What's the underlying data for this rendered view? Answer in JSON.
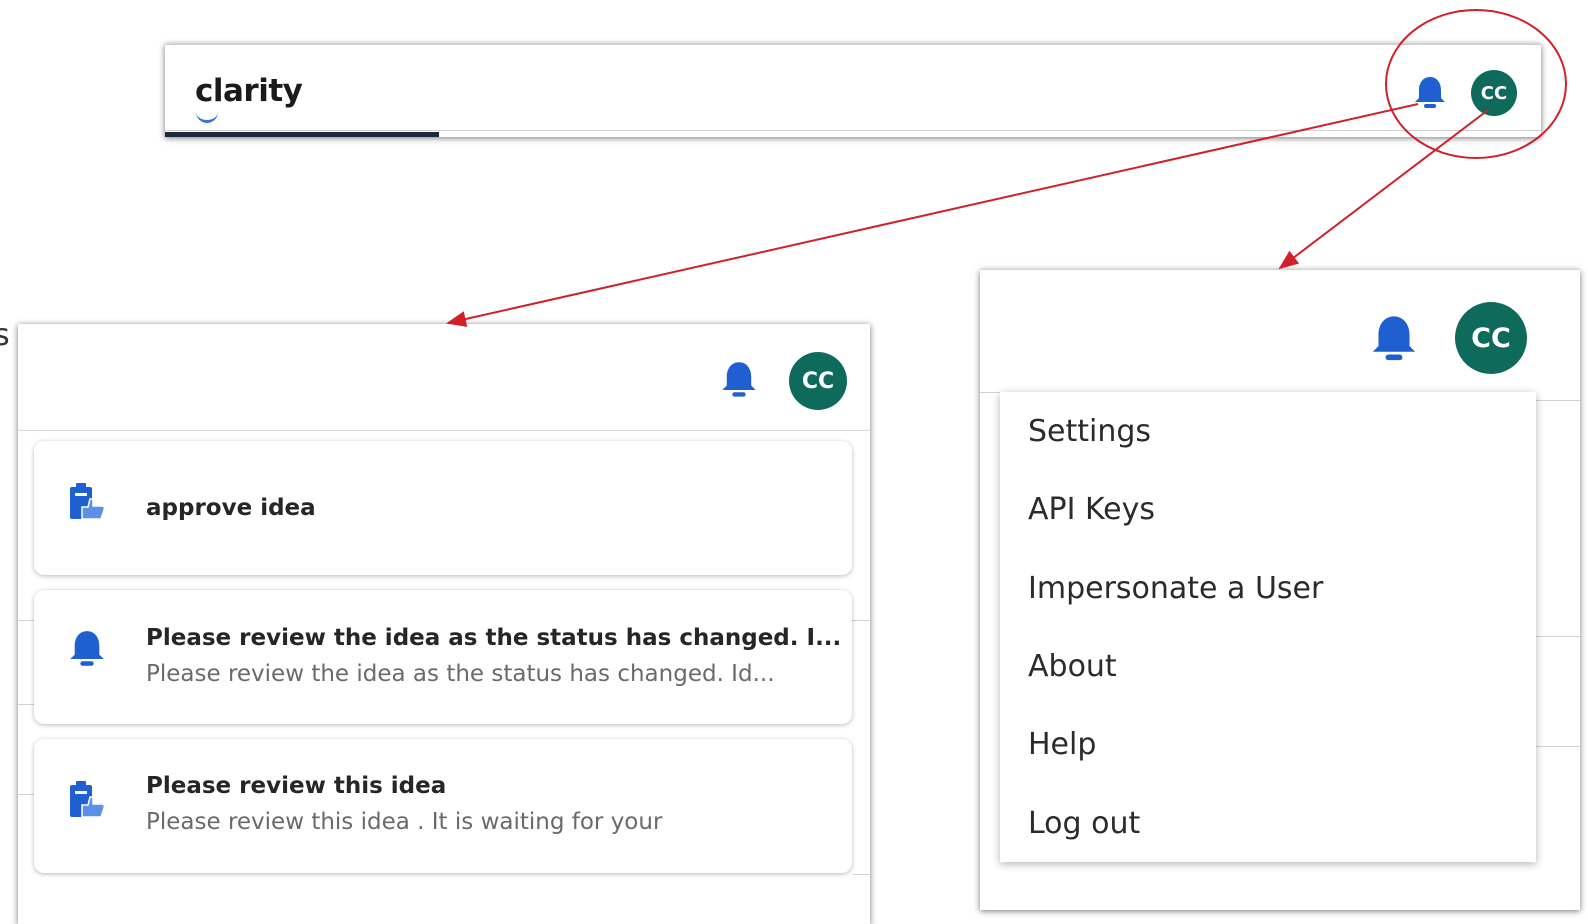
{
  "header": {
    "logo_text": "clarity",
    "avatar_initials": "CC"
  },
  "notifications_panel": {
    "avatar_initials": "CC",
    "items": [
      {
        "icon": "approve-idea-icon",
        "title": "approve idea",
        "body": ""
      },
      {
        "icon": "bell-icon",
        "title": "Please review the idea as the status has changed. I...",
        "body": "Please review the idea as the status has changed. Id..."
      },
      {
        "icon": "approve-idea-icon",
        "title": "Please review this idea",
        "body": "Please review this idea . It is waiting for your"
      }
    ]
  },
  "user_menu_panel": {
    "avatar_initials": "CC",
    "items": [
      "Settings",
      "API Keys",
      "Impersonate a User",
      "About",
      "Help",
      "Log out"
    ]
  },
  "edge_fragment": "s",
  "colors": {
    "bell": "#1f5fd0",
    "avatar": "#0e6b5c",
    "annotation": "#d0202a",
    "tab_underline": "#1d2a3e"
  }
}
